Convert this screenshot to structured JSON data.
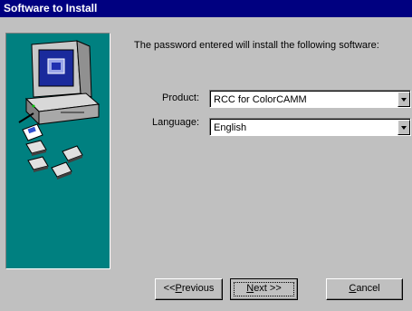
{
  "window": {
    "title": "Software to Install"
  },
  "intro_text": "The password entered will install the following software:",
  "product": {
    "label": "Product:",
    "value": "RCC for ColorCAMM"
  },
  "language": {
    "label": "Language:",
    "value": "English"
  },
  "buttons": {
    "previous": {
      "mnemonic": "P",
      "prefix": "<<",
      "rest": "revious"
    },
    "next": {
      "mnemonic": "N",
      "prefix": "",
      "rest": "ext >>"
    },
    "cancel": {
      "mnemonic": "C",
      "prefix": "",
      "rest": "ancel"
    }
  },
  "icons": [
    "computer-icon",
    "floppy-disk-icon"
  ],
  "colors": {
    "title_bar": "#000080",
    "side_panel": "#008080",
    "face": "#c0c0c0"
  }
}
